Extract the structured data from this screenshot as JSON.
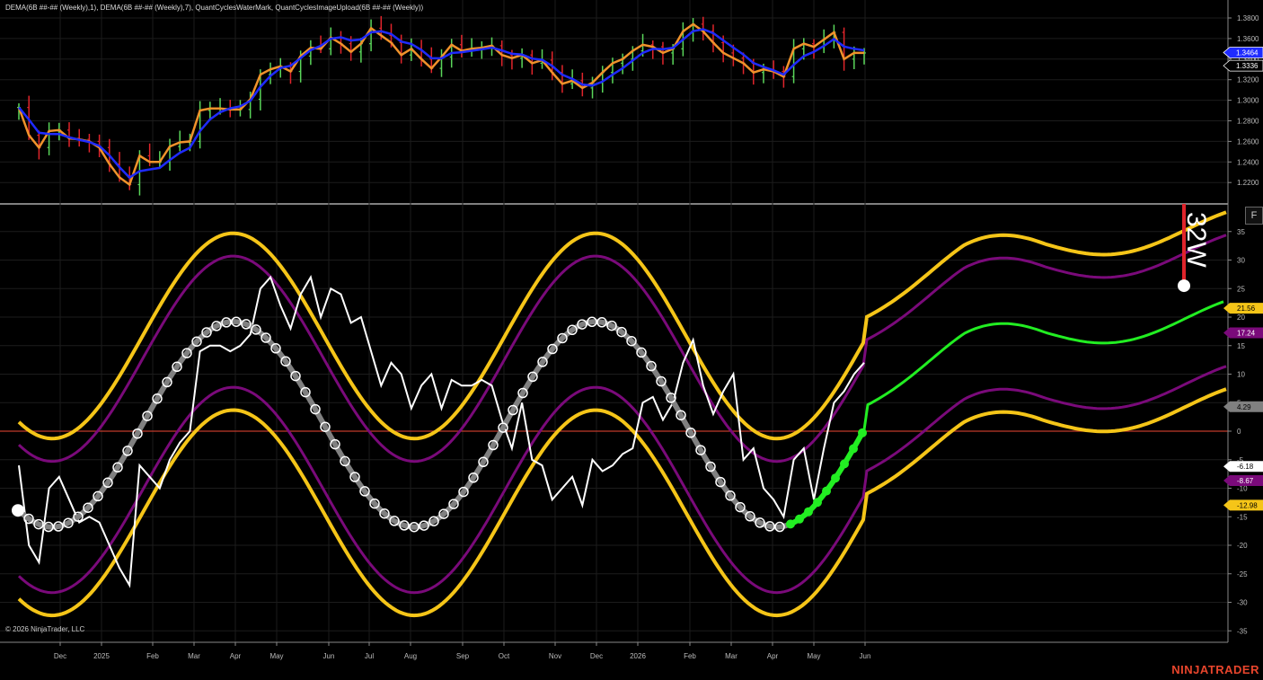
{
  "legend_text": "DEMA(6B ##-## (Weekly),1), DEMA(6B ##-## (Weekly),7), QuantCyclesWaterMark, QuantCyclesImageUpload(6B ##-## (Weekly))",
  "copyright": "© 2026 NinjaTrader, LLC",
  "brand": "NINJATRADER",
  "f_button": "F",
  "cycle_label": "32W",
  "colors": {
    "background": "#000000",
    "fast_dema": "#f0922b",
    "slow_dema": "#1f2bff",
    "up_bar": "#5ad65a",
    "down_bar": "#e0242b",
    "outer_band": "#f5c518",
    "inner_band": "#7a0a7a",
    "cycle": "#808080",
    "projection": "#22ee22",
    "raw_oscillator": "#ffffff",
    "zero_line": "#c0392b",
    "cycle_marker": "#e0242b"
  },
  "chart_data": [
    {
      "type": "line",
      "name": "price-panel",
      "y_ticks": [
        "1.3800",
        "1.3600",
        "1.3400",
        "1.3200",
        "1.3000",
        "1.2800",
        "1.2600",
        "1.2400",
        "1.2200"
      ],
      "ylim": [
        1.2,
        1.39
      ],
      "price_tags": [
        {
          "value": 1.3464,
          "label": "1.3464",
          "color": "#1f2bff"
        },
        {
          "value": 1.3336,
          "label": "1.3336",
          "color": "#ffffff"
        }
      ],
      "x_labels": [
        "Dec",
        "2025",
        "Feb",
        "Mar",
        "Apr",
        "May",
        "Jun",
        "Jul",
        "Aug",
        "Sep",
        "Oct",
        "Nov",
        "Dec",
        "2026",
        "Feb",
        "Mar",
        "Apr",
        "May",
        "Jun"
      ],
      "closes": [
        1.293,
        1.266,
        1.254,
        1.27,
        1.271,
        1.263,
        1.262,
        1.26,
        1.254,
        1.238,
        1.225,
        1.218,
        1.246,
        1.24,
        1.24,
        1.255,
        1.259,
        1.26,
        1.29,
        1.292,
        1.292,
        1.291,
        1.291,
        1.301,
        1.325,
        1.33,
        1.333,
        1.328,
        1.343,
        1.351,
        1.35,
        1.361,
        1.355,
        1.347,
        1.355,
        1.37,
        1.363,
        1.356,
        1.344,
        1.35,
        1.34,
        1.331,
        1.342,
        1.354,
        1.348,
        1.35,
        1.351,
        1.353,
        1.344,
        1.341,
        1.344,
        1.336,
        1.339,
        1.327,
        1.316,
        1.319,
        1.312,
        1.317,
        1.327,
        1.336,
        1.34,
        1.348,
        1.354,
        1.352,
        1.346,
        1.35,
        1.367,
        1.374,
        1.367,
        1.356,
        1.346,
        1.341,
        1.336,
        1.327,
        1.33,
        1.328,
        1.323,
        1.35,
        1.355,
        1.352,
        1.359,
        1.366,
        1.34,
        1.346,
        1.346
      ],
      "series": [
        {
          "name": "DEMA 1",
          "color": "#f0922b"
        },
        {
          "name": "DEMA 7",
          "color": "#1f2bff"
        }
      ]
    },
    {
      "type": "line",
      "name": "cycle-oscillator-panel",
      "y_ticks": [
        "35",
        "30",
        "25",
        "20",
        "15",
        "10",
        "5",
        "0",
        "-5",
        "-10",
        "-15",
        "-20",
        "-25",
        "-30",
        "-35"
      ],
      "ylim": [
        -36,
        40
      ],
      "tags": [
        {
          "value": 21.56,
          "label": "21.56",
          "color": "#f5c518"
        },
        {
          "value": 17.24,
          "label": "17.24",
          "color": "#7a0a7a"
        },
        {
          "value": 4.29,
          "label": "4.29",
          "color": "#808080"
        },
        {
          "value": -6.18,
          "label": "-6.18",
          "color": "#ffffff"
        },
        {
          "value": -8.67,
          "label": "-8.67",
          "color": "#7a0a7a"
        },
        {
          "value": -12.98,
          "label": "-12.98",
          "color": "#f5c518"
        }
      ],
      "cycle_period_label": "32W",
      "cycle_peak_value": 25.5,
      "series": [
        {
          "name": "outer upper band",
          "color": "#f5c518"
        },
        {
          "name": "inner upper band",
          "color": "#7a0a7a"
        },
        {
          "name": "inner lower band",
          "color": "#7a0a7a"
        },
        {
          "name": "outer lower band",
          "color": "#f5c518"
        },
        {
          "name": "dominant cycle",
          "color": "#808080"
        },
        {
          "name": "projection",
          "color": "#22ee22"
        },
        {
          "name": "raw oscillator",
          "color": "#ffffff"
        }
      ],
      "raw_oscillator": [
        -6,
        -20,
        -23,
        -10,
        -8,
        -12,
        -16,
        -15,
        -16,
        -20,
        -24,
        -27,
        -6,
        -8,
        -10,
        -5,
        -2,
        0,
        14,
        15,
        15,
        14,
        15,
        17,
        25,
        27,
        22,
        18,
        24,
        27,
        20,
        25,
        24,
        19,
        20,
        14,
        8,
        12,
        10,
        4,
        8,
        10,
        4,
        9,
        8,
        8,
        9,
        8,
        2,
        -3,
        5,
        -5,
        -6,
        -12,
        -10,
        -8,
        -13,
        -5,
        -7,
        -6,
        -4,
        -3,
        5,
        6,
        2,
        5,
        12,
        16,
        8,
        3,
        7,
        10,
        -5,
        -3,
        -10,
        -12,
        -15,
        -5,
        -3,
        -12,
        -3,
        5,
        7,
        10,
        12
      ]
    }
  ]
}
